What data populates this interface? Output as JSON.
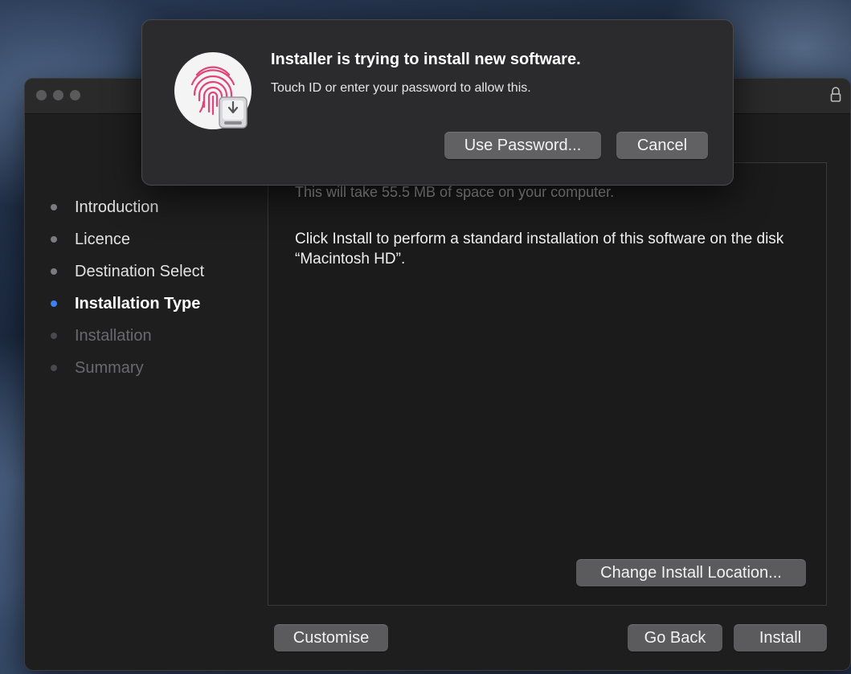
{
  "auth_dialog": {
    "title": "Installer is trying to install new software.",
    "subtitle": "Touch ID or enter your password to allow this.",
    "use_password_label": "Use Password...",
    "cancel_label": "Cancel",
    "icon": "touch-id-fingerprint-icon"
  },
  "window": {
    "lock_icon": "lock-icon",
    "steps": [
      {
        "label": "Introduction",
        "state": "done"
      },
      {
        "label": "Licence",
        "state": "done"
      },
      {
        "label": "Destination Select",
        "state": "done"
      },
      {
        "label": "Installation Type",
        "state": "current"
      },
      {
        "label": "Installation",
        "state": "future"
      },
      {
        "label": "Summary",
        "state": "future"
      }
    ],
    "content": {
      "space_text": "This will take 55.5 MB of space on your computer.",
      "instruction_text": "Click Install to perform a standard installation of this software on the disk “Macintosh HD”."
    },
    "buttons": {
      "change_location_label": "Change Install Location...",
      "customise_label": "Customise",
      "go_back_label": "Go Back",
      "install_label": "Install"
    }
  },
  "colors": {
    "current_step_dot": "#3b82f6",
    "fingerprint": "#e0457a"
  }
}
